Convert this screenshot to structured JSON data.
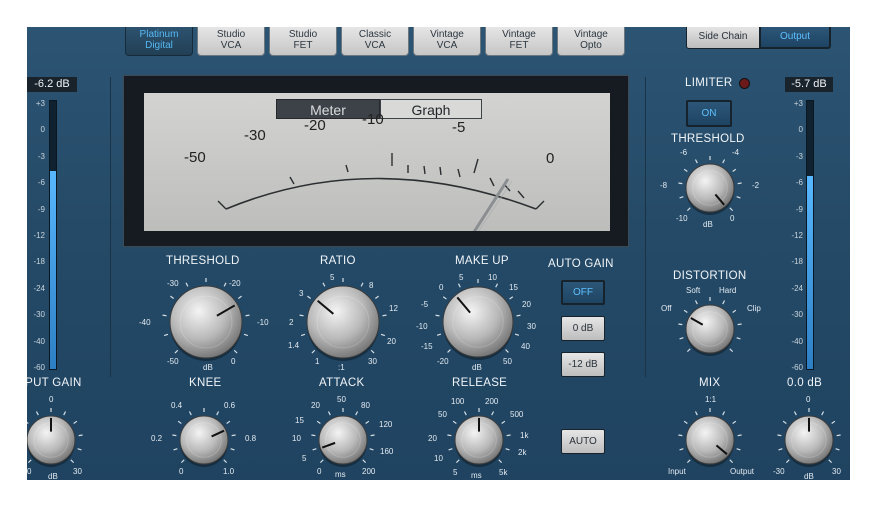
{
  "models": [
    {
      "line1": "Platinum",
      "line2": "Digital",
      "active": true
    },
    {
      "line1": "Studio",
      "line2": "VCA",
      "active": false
    },
    {
      "line1": "Studio",
      "line2": "FET",
      "active": false
    },
    {
      "line1": "Classic",
      "line2": "VCA",
      "active": false
    },
    {
      "line1": "Vintage",
      "line2": "VCA",
      "active": false
    },
    {
      "line1": "Vintage",
      "line2": "FET",
      "active": false
    },
    {
      "line1": "Vintage",
      "line2": "Opto",
      "active": false
    }
  ],
  "view_tabs": {
    "side_chain": "Side Chain",
    "output": "Output"
  },
  "meter": {
    "tabs": {
      "meter": "Meter",
      "graph": "Graph"
    },
    "scale": [
      "-50",
      "-30",
      "-20",
      "-10",
      "-5",
      "0"
    ]
  },
  "input": {
    "readout": "-6.2 dB",
    "scale": [
      "+3",
      "0",
      "-3",
      "-6",
      "-9",
      "-12",
      "-18",
      "-24",
      "-30",
      "-40",
      "-60"
    ],
    "level": 0.74,
    "knob_label": "INPUT GAIN",
    "knob_top": "0",
    "knob_left": "0",
    "knob_unit": "dB",
    "knob_right": "30"
  },
  "output": {
    "readout": "-5.7 dB",
    "scale": [
      "+3",
      "0",
      "-3",
      "-6",
      "-9",
      "-12",
      "-18",
      "-24",
      "-30",
      "-40",
      "-60"
    ],
    "level": 0.72,
    "gain_readout": "0.0 dB",
    "knob_top": "0",
    "knob_left": "-30",
    "knob_unit": "dB",
    "knob_right": "30"
  },
  "threshold": {
    "label": "THRESHOLD",
    "ticks": [
      "-30",
      "-20",
      "-40",
      "-10",
      "-50",
      "0"
    ],
    "unit": "dB"
  },
  "ratio": {
    "label": "RATIO",
    "ticks": [
      "5",
      "3",
      "8",
      "2",
      "12",
      "1.4",
      "20",
      "1",
      "30"
    ],
    "unit": ":1"
  },
  "makeup": {
    "label": "MAKE UP",
    "ticks": [
      "5",
      "10",
      "0",
      "15",
      "-5",
      "20",
      "-10",
      "30",
      "-15",
      "40",
      "-20",
      "50"
    ],
    "unit": "dB"
  },
  "auto_gain": {
    "label": "AUTO GAIN",
    "off": "OFF",
    "zero": "0 dB",
    "minus12": "-12 dB"
  },
  "knee": {
    "label": "KNEE",
    "ticks": [
      "0.4",
      "0.6",
      "0.2",
      "0.8",
      "0",
      "1.0"
    ]
  },
  "attack": {
    "label": "ATTACK",
    "ticks": [
      "20",
      "50",
      "80",
      "15",
      "120",
      "10",
      "160",
      "5",
      "0",
      "200"
    ],
    "unit": "ms"
  },
  "release": {
    "label": "RELEASE",
    "ticks": [
      "100",
      "200",
      "50",
      "500",
      "20",
      "1k",
      "10",
      "2k",
      "5",
      "5k"
    ],
    "unit": "ms",
    "auto": "AUTO"
  },
  "limiter": {
    "label": "LIMITER",
    "on": "ON",
    "threshold_label": "THRESHOLD",
    "ticks": [
      "-6",
      "-4",
      "-8",
      "-2",
      "-10",
      "0"
    ],
    "unit": "dB"
  },
  "distortion": {
    "label": "DISTORTION",
    "soft": "Soft",
    "hard": "Hard",
    "off": "Off",
    "clip": "Clip"
  },
  "mix": {
    "label": "MIX",
    "ratio": "1:1",
    "input": "Input",
    "output": "Output"
  },
  "colors": {
    "panel": "#244a67",
    "accent": "#5ec0ff",
    "led": "#7a1f1f"
  }
}
